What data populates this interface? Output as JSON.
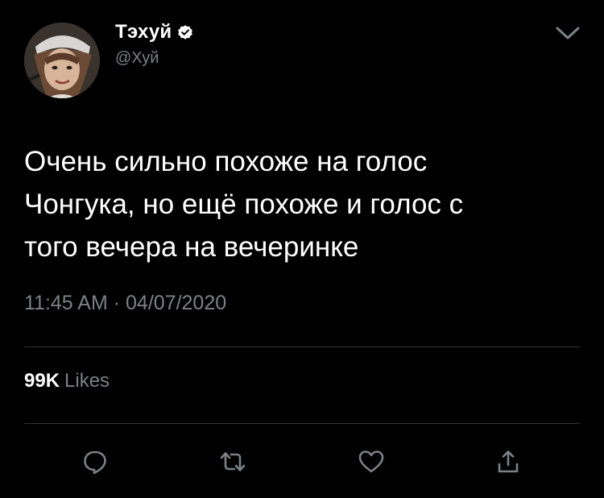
{
  "user": {
    "display_name": "Тэхуй",
    "handle": "@Хуй",
    "verified": true,
    "avatar_icon": "profile-photo"
  },
  "tweet": {
    "text": "Очень сильно похоже на голос\nЧонгука, но ещё похоже и голос с\nтого вечера на вечеринке",
    "time": "11:45 AM",
    "separator": "·",
    "date": "04/07/2020"
  },
  "stats": {
    "likes_count": "99K",
    "likes_label": "Likes"
  },
  "actions": {
    "reply_icon": "reply-icon",
    "retweet_icon": "retweet-icon",
    "like_icon": "heart-icon",
    "share_icon": "share-icon"
  },
  "colors": {
    "background": "#000000",
    "text": "#ffffff",
    "secondary": "#7b8186",
    "divider": "#2f3336",
    "icon": "#7b8186"
  }
}
